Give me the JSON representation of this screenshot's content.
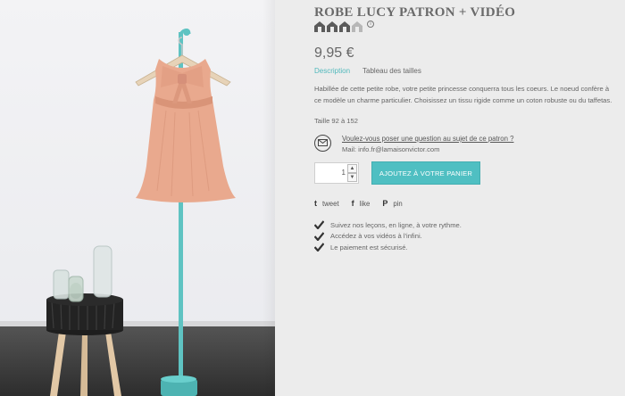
{
  "product": {
    "title": "ROBE LUCY PATRON + VIDÉO",
    "difficulty_level": 3,
    "difficulty_max": 4,
    "info_glyph": "i",
    "price": "9,95 €"
  },
  "tabs": [
    {
      "label": "Description",
      "active": true
    },
    {
      "label": "Tableau des tailles",
      "active": false
    }
  ],
  "description": "Habillée de cette petite robe, votre petite princesse conquerra tous les coeurs. Le noeud confère à ce modèle un charme particulier. Choisissez un tissu rigide comme un coton robuste ou du taffetas.",
  "sizes": "Taille 92 à 152",
  "question": {
    "link": "Voulez-vous poser une question au sujet de ce patron ?",
    "mail": "Mail: info.fr@lamaisonvictor.com"
  },
  "cart": {
    "quantity": "1",
    "up_glyph": "▲",
    "down_glyph": "▼",
    "add_label": "AJOUTEZ À VOTRE PANIER"
  },
  "share": [
    {
      "glyph": "t",
      "label": "tweet"
    },
    {
      "glyph": "f",
      "label": "like"
    },
    {
      "glyph": "P",
      "label": "pin"
    }
  ],
  "benefits": [
    "Suivez nos leçons, en ligne, à votre rythme.",
    "Accédez à vos vidéos à l'infini.",
    "Le paiement est sécurisé."
  ],
  "colors": {
    "accent": "#4fbfc2",
    "dress": "#e8a78c",
    "stand": "#5fc3c2",
    "background": "#ececec"
  }
}
